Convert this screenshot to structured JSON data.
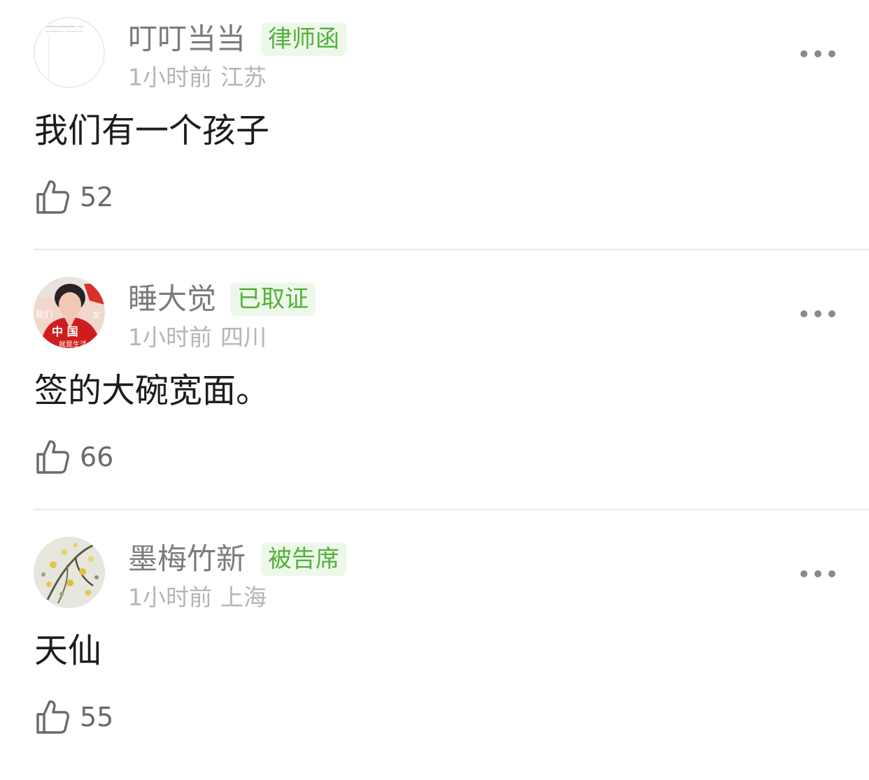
{
  "comments": [
    {
      "username": "叮叮当当",
      "badge": "律师函",
      "time": "1小时前",
      "location": "江苏",
      "content": "我们有一个孩子",
      "likes": "52",
      "avatar_icon": "document-thumbnail-avatar"
    },
    {
      "username": "睡大觉",
      "badge": "已取证",
      "time": "1小时前",
      "location": "四川",
      "content": "签的大碗宽面。",
      "likes": "66",
      "avatar_icon": "person-photo-avatar",
      "avatar_text": "我们 中国 女 就是生活"
    },
    {
      "username": "墨梅竹新",
      "badge": "被告席",
      "time": "1小时前",
      "location": "上海",
      "content": "天仙",
      "likes": "55",
      "avatar_icon": "flower-painting-avatar"
    }
  ],
  "colors": {
    "badge_text": "#52b13a",
    "badge_bg": "#eef8ea",
    "username": "#7b7b7b",
    "meta": "#b5b5b5",
    "content": "#1c1c1c"
  }
}
